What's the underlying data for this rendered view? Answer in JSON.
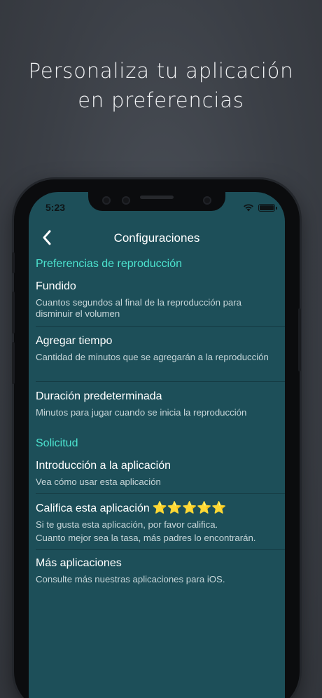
{
  "headline": {
    "line1": "Personaliza tu aplicación",
    "line2": "en preferencias"
  },
  "status_bar": {
    "time": "5:23"
  },
  "nav": {
    "title": "Configuraciones"
  },
  "sections": {
    "playback": {
      "header": "Preferencias de reproducción",
      "items": [
        {
          "title": "Fundido",
          "desc": "Cuantos segundos al final de la reproducción para disminuir el volumen"
        },
        {
          "title": "Agregar tiempo",
          "desc": "Cantidad de minutos que se agregarán a la reproducción"
        },
        {
          "title": "Duración predeterminada",
          "desc": "Minutos para jugar cuando se inicia la reproducción"
        }
      ]
    },
    "app": {
      "header": "Solicitud",
      "items": [
        {
          "title": "Introducción a la aplicación",
          "desc": "Vea cómo usar esta aplicación"
        },
        {
          "title": "Califica esta aplicación",
          "stars": "⭐⭐⭐⭐⭐",
          "desc": "Si te gusta esta aplicación, por favor califica.",
          "desc2": "Cuanto mejor sea la tasa, más padres lo encontrarán."
        },
        {
          "title": "Más aplicaciones",
          "desc": "Consulte más nuestras aplicaciones para iOS."
        }
      ]
    }
  },
  "colors": {
    "screen_bg": "#1d4f59",
    "accent": "#4ce3cf"
  }
}
